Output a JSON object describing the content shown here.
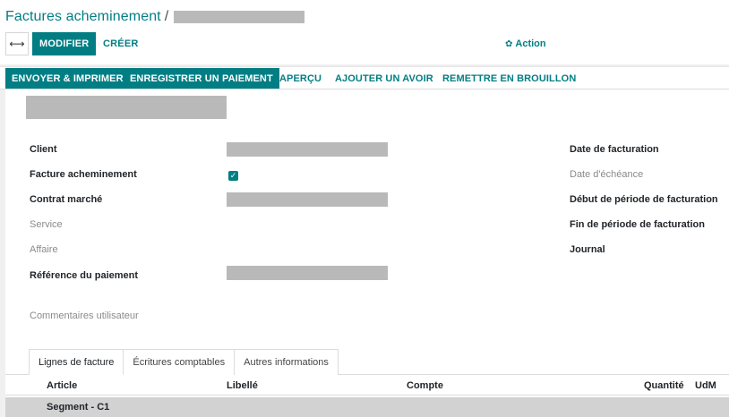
{
  "breadcrumb": {
    "title": "Factures acheminement",
    "separator": "/"
  },
  "control_panel": {
    "toggle_glyph": "⟷",
    "edit_label": "MODIFIER",
    "create_label": "CRÉER",
    "action_label": "Action",
    "action_icon": "gear-icon"
  },
  "statusbar": {
    "buttons": [
      {
        "label": "ENVOYER & IMPRIMER",
        "primary": true
      },
      {
        "label": "ENREGISTRER UN PAIEMENT",
        "primary": true
      },
      {
        "label": "APERÇU",
        "primary": false
      },
      {
        "label": "AJOUTER UN AVOIR",
        "primary": false
      },
      {
        "label": "REMETTRE EN BROUILLON",
        "primary": false
      }
    ]
  },
  "form": {
    "left_fields": [
      {
        "label": "Client"
      },
      {
        "label": "Facture acheminement",
        "checked": true
      },
      {
        "label": "Contrat marché"
      },
      {
        "label": "Service"
      },
      {
        "label": "Affaire"
      },
      {
        "label": "Référence du paiement"
      },
      {
        "label": "Commentaires utilisateur"
      }
    ],
    "right_fields": [
      {
        "label": "Date de facturation"
      },
      {
        "label": "Date d'échéance"
      },
      {
        "label": "Début de période de facturation"
      },
      {
        "label": "Fin de période de facturation"
      },
      {
        "label": "Journal"
      }
    ]
  },
  "tabs": [
    {
      "label": "Lignes de facture",
      "active": true
    },
    {
      "label": "Écritures comptables",
      "active": false
    },
    {
      "label": "Autres informations",
      "active": false
    }
  ],
  "lines_table": {
    "columns": [
      "Article",
      "Libellé",
      "Compte",
      "Quantité",
      "UdM"
    ],
    "section": "Segment - C1"
  },
  "colors": {
    "accent": "#017e84",
    "redaction": "#b9b9b9",
    "background": "#f0f0f0"
  }
}
